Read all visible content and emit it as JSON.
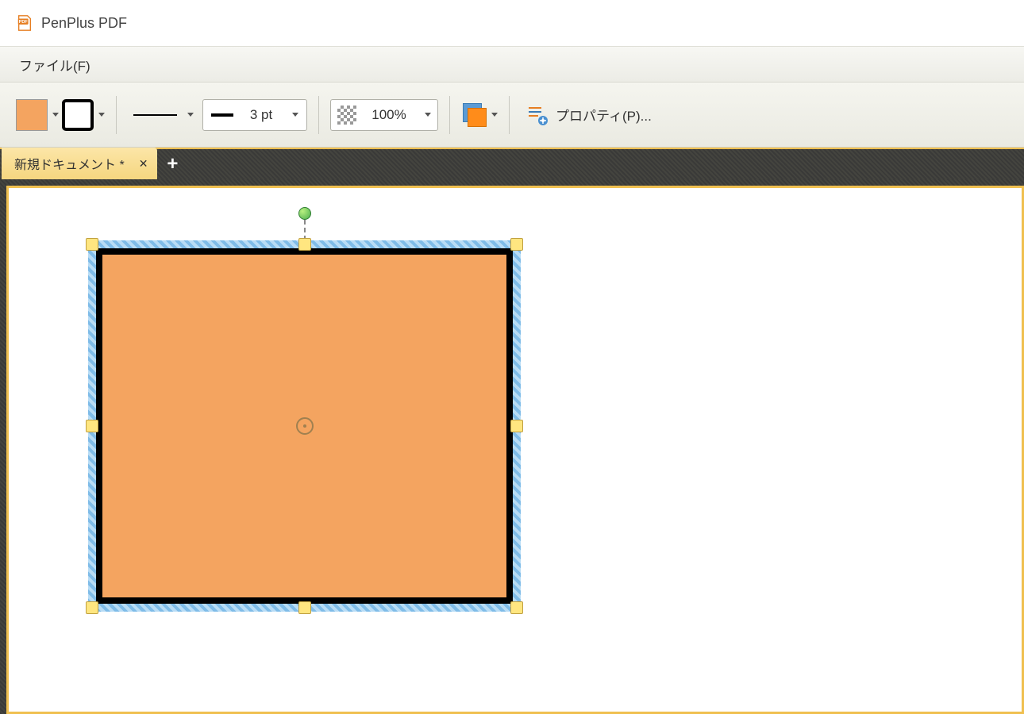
{
  "app": {
    "title": "PenPlus PDF"
  },
  "menu": {
    "file": "ファイル(F)"
  },
  "toolbar": {
    "fill_color": "#f4a460",
    "line_weight": "3 pt",
    "opacity": "100%",
    "properties_label": "プロパティ(P)..."
  },
  "tabs": {
    "active": "新規ドキュメント *",
    "modified": true
  },
  "canvas": {
    "selected_shape": {
      "type": "rectangle",
      "fill": "#f4a460",
      "stroke": "#000000",
      "stroke_width": "8px"
    }
  }
}
